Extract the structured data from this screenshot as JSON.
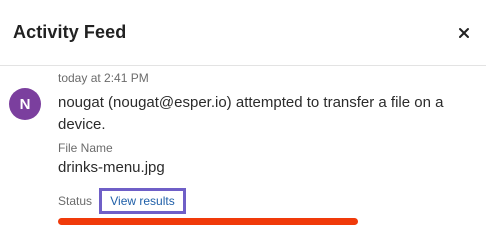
{
  "header": {
    "title": "Activity Feed",
    "close_icon": "close-icon"
  },
  "activity": {
    "timestamp": "today at 2:41 PM",
    "avatar_initial": "N",
    "avatar_color": "#7b3f9e",
    "message": "nougat (nougat@esper.io) attempted to transfer a file on a device.",
    "file_name_label": "File Name",
    "file_name": "drinks-menu.jpg",
    "status_label": "Status",
    "view_results_label": "View results",
    "progress_fraction": 1.0
  },
  "colors": {
    "accent_link": "#1f5fa8",
    "highlight_border": "#6f5fc7",
    "progress": "#f03a0a"
  }
}
